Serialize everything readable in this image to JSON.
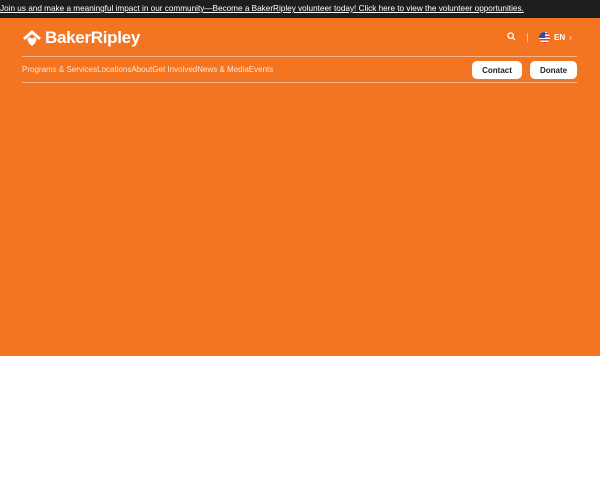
{
  "banner": {
    "text": "Join us and make a meaningful impact in our community—Become a BakerRipley volunteer today! Click here to view the volunteer opportunities."
  },
  "header": {
    "logo_text": "BakerRipley",
    "language": "EN"
  },
  "nav": {
    "items": [
      "Programs & Services",
      "Locations",
      "About",
      "Get Involved",
      "News & Media",
      "Events"
    ]
  },
  "buttons": {
    "contact": "Contact",
    "donate": "Donate"
  },
  "colors": {
    "brand": "#f47521",
    "banner_bg": "#1e1e1e"
  }
}
